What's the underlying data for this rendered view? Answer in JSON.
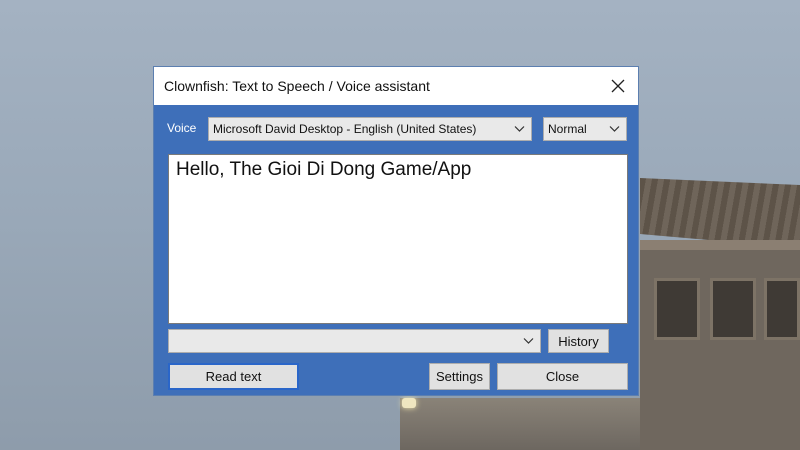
{
  "window": {
    "title": "Clownfish: Text to Speech / Voice assistant",
    "close_icon": "close-icon"
  },
  "voice": {
    "label": "Voice",
    "selected": "Microsoft David Desktop - English (United States)",
    "rate_selected": "Normal"
  },
  "text_input": {
    "value": "Hello, The Gioi Di Dong Game/App"
  },
  "history": {
    "selected": "",
    "button_label": "History"
  },
  "buttons": {
    "read_text": "Read text",
    "settings": "Settings",
    "close": "Close"
  },
  "colors": {
    "window_body": "#3e6fb9",
    "titlebar": "#ffffff",
    "focus_border": "#2a66c9"
  }
}
